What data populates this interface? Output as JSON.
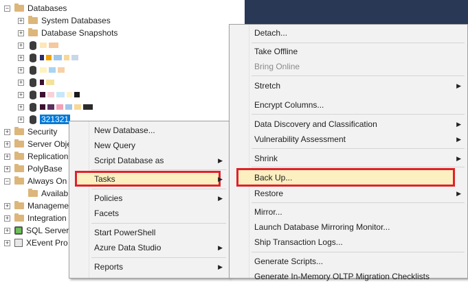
{
  "tree": {
    "root": "Databases",
    "items": [
      {
        "label": "System Databases"
      },
      {
        "label": "Database Snapshots"
      }
    ],
    "selected_db": "321321",
    "server_items": [
      {
        "label": "Security"
      },
      {
        "label": "Server Obje"
      },
      {
        "label": "Replication"
      },
      {
        "label": "PolyBase"
      },
      {
        "label": "Always On"
      },
      {
        "label": "Availab"
      },
      {
        "label": "Manageme"
      },
      {
        "label": "Integration"
      },
      {
        "label": "SQL Server"
      },
      {
        "label": "XEvent Pro"
      }
    ]
  },
  "context_menu": {
    "items": [
      {
        "label": "New Database..."
      },
      {
        "label": "New Query"
      },
      {
        "label": "Script Database as"
      },
      {
        "label": "Tasks"
      },
      {
        "label": "Policies"
      },
      {
        "label": "Facets"
      },
      {
        "label": "Start PowerShell"
      },
      {
        "label": "Azure Data Studio"
      },
      {
        "label": "Reports"
      }
    ]
  },
  "tasks_menu": {
    "items": [
      {
        "label": "Detach..."
      },
      {
        "label": "Take Offline"
      },
      {
        "label": "Bring Online"
      },
      {
        "label": "Stretch"
      },
      {
        "label": "Encrypt Columns..."
      },
      {
        "label": "Data Discovery and Classification"
      },
      {
        "label": "Vulnerability Assessment"
      },
      {
        "label": "Shrink"
      },
      {
        "label": "Back Up..."
      },
      {
        "label": "Restore"
      },
      {
        "label": "Mirror..."
      },
      {
        "label": "Launch Database Mirroring Monitor..."
      },
      {
        "label": "Ship Transaction Logs..."
      },
      {
        "label": "Generate Scripts..."
      },
      {
        "label": "Generate In-Memory OLTP Migration Checklists"
      }
    ]
  },
  "colors": {
    "highlight_border": "#e0202a",
    "selection": "#0078d7",
    "dark_panel": "#293955"
  }
}
